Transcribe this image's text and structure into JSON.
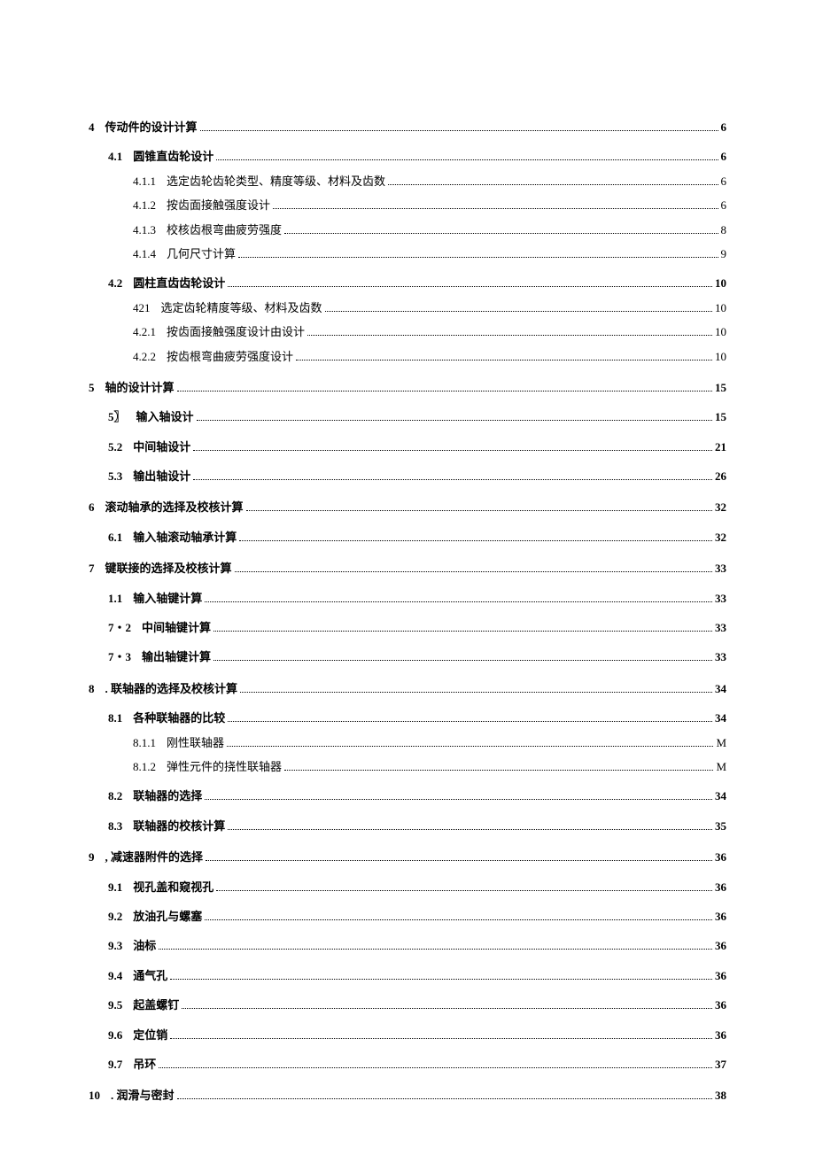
{
  "toc": [
    {
      "level": 0,
      "num": "4",
      "title": "传动件的设计计算",
      "sep": " ",
      "page": "6"
    },
    {
      "level": 1,
      "num": "4.1",
      "title": "圆锥直齿轮设计",
      "page": "6"
    },
    {
      "level": 2,
      "num": "4.1.1",
      "title": "选定齿轮齿轮类型、精度等级、材料及齿数",
      "page": "6"
    },
    {
      "level": 2,
      "num": "4.1.2",
      "title": "按齿面接触强度设计",
      "page": "6"
    },
    {
      "level": 2,
      "num": "4.1.3",
      "title": "校核齿根弯曲疲劳强度",
      "page": "8"
    },
    {
      "level": 2,
      "num": "4.1.4",
      "title": "几何尺寸计算",
      "page": "9"
    },
    {
      "level": 1,
      "num": "4.2",
      "title": "圆柱直齿齿轮设计",
      "page": "10"
    },
    {
      "level": 2,
      "num": "421",
      "title": "选定齿轮精度等级、材料及齿数",
      "sep": " ",
      "page": "10"
    },
    {
      "level": 2,
      "num": "4.2.1",
      "title": "按齿面接触强度设计由设计",
      "page": "10"
    },
    {
      "level": 2,
      "num": "4.2.2",
      "title": "按齿根弯曲疲劳强度设计",
      "page": "10"
    },
    {
      "level": 0,
      "num": "5",
      "title": "轴的设计计算",
      "sep": " ",
      "page": "15"
    },
    {
      "level": 1,
      "num": "5〗",
      "title": "输入轴设计",
      "sep": "",
      "page": "15"
    },
    {
      "level": 1,
      "num": "5.2",
      "title": "中间轴设计",
      "page": "21"
    },
    {
      "level": 1,
      "num": "5.3",
      "title": "输出轴设计",
      "page": "26"
    },
    {
      "level": 0,
      "num": "6",
      "title": "滚动轴承的选择及校核计算",
      "sep": " ",
      "page": "32"
    },
    {
      "level": 1,
      "num": "6.1",
      "title": "输入轴滚动轴承计算",
      "sep": " ",
      "page": "32"
    },
    {
      "level": 0,
      "num": "7",
      "title": "键联接的选择及校核计算",
      "sep": " ",
      "page": "33"
    },
    {
      "level": 1,
      "num": "1.1",
      "title": "输入轴键计算",
      "page": "33"
    },
    {
      "level": 1,
      "num": "7・2",
      "title": "中间轴键计算",
      "sep": " ",
      "page": "33"
    },
    {
      "level": 1,
      "num": "7・3",
      "title": "输出轴键计算",
      "sep": " ",
      "page": "33"
    },
    {
      "level": 0,
      "num": "8",
      "title": ". 联轴器的选择及校核计算",
      "page": "34"
    },
    {
      "level": 1,
      "num": "8.1",
      "title": "各种联轴器的比较",
      "page": "34"
    },
    {
      "level": 2,
      "num": "8.1.1",
      "title": "刚性联轴器",
      "page": "M"
    },
    {
      "level": 2,
      "num": "8.1.2",
      "title": "弹性元件的挠性联轴器",
      "page": "M"
    },
    {
      "level": 1,
      "num": "8.2",
      "title": "联轴器的选择",
      "page": "34"
    },
    {
      "level": 1,
      "num": "8.3",
      "title": "联轴器的校核计算",
      "page": "35"
    },
    {
      "level": 0,
      "num": "9",
      "title": ", 减速器附件的选择",
      "page": "36"
    },
    {
      "level": 1,
      "num": "9.1",
      "title": "视孔盖和窥视孔",
      "page": "36"
    },
    {
      "level": 1,
      "num": "9.2",
      "title": "放油孔与螺塞",
      "page": "36"
    },
    {
      "level": 1,
      "num": "9.3",
      "title": "油标",
      "page": "36"
    },
    {
      "level": 1,
      "num": "9.4",
      "title": "通气孔",
      "page": "36"
    },
    {
      "level": 1,
      "num": "9.5",
      "title": "起盖螺钉",
      "page": "36"
    },
    {
      "level": 1,
      "num": "9.6",
      "title": "定位销",
      "page": "36"
    },
    {
      "level": 1,
      "num": "9.7",
      "title": "吊环",
      "page": "37"
    },
    {
      "level": 0,
      "num": "10",
      "title": ". 润滑与密封",
      "page": "38"
    }
  ]
}
